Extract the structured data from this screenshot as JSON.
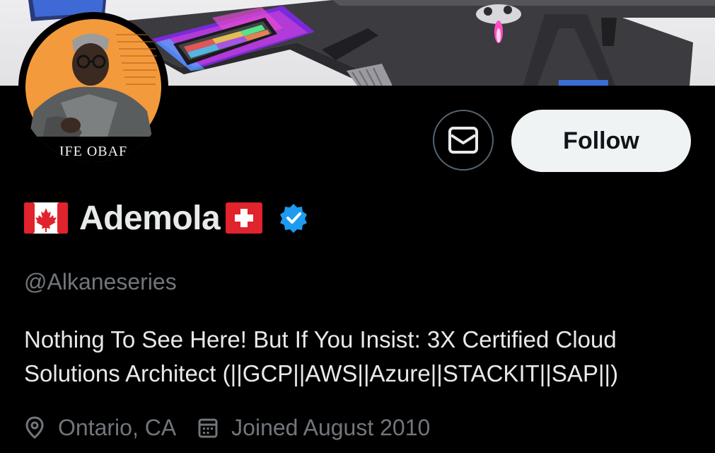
{
  "profile": {
    "display_name": "Ademola",
    "handle": "@Alkaneseries",
    "avatar_caption": "IFE OBAF",
    "bio_lines": [
      "Nothing To See Here! But If You Insist: 3X Certified Cloud",
      "Solutions Architect (||GCP||AWS||Azure||STACKIT||SAP||)"
    ],
    "location": "Ontario, CA",
    "joined": "Joined August 2010",
    "flags": [
      "canada-flag",
      "switzerland-flag"
    ],
    "verified": true
  },
  "actions": {
    "follow_label": "Follow",
    "message_icon": "envelope-icon"
  },
  "icons": {
    "location": "location-pin-icon",
    "joined": "calendar-icon",
    "verified": "verified-badge-icon"
  },
  "colors": {
    "background": "#000000",
    "primary_text": "#e7e9ea",
    "secondary_text": "#71767b",
    "verified_blue": "#1d9bf0",
    "follow_bg": "#eff3f4",
    "button_border": "#536471",
    "avatar_bg": "#f39a3c"
  }
}
